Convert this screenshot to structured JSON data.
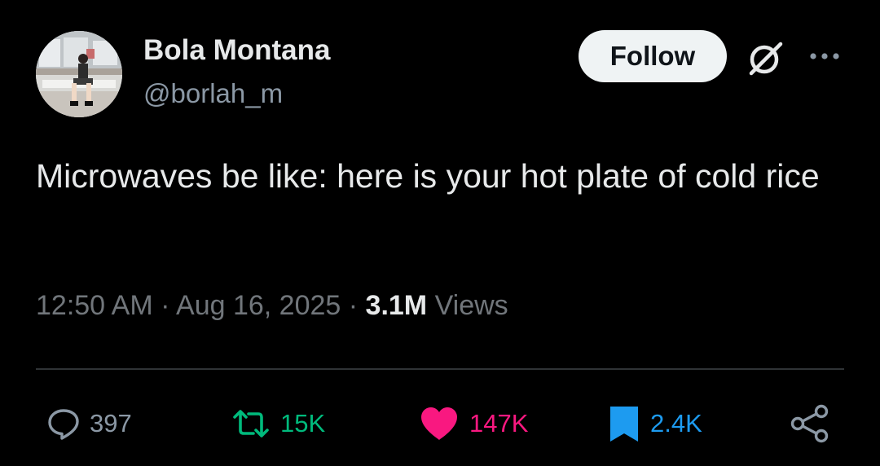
{
  "author": {
    "display_name": "Bola Montana",
    "handle": "@borlah_m"
  },
  "header": {
    "follow_label": "Follow",
    "grok_icon": "grok-icon",
    "more_icon": "more-icon"
  },
  "tweet": {
    "text": "Microwaves be like: here is your hot plate of cold rice"
  },
  "meta": {
    "time": "12:50 AM",
    "separator": "·",
    "date": "Aug 16, 2025",
    "views_count": "3.1M",
    "views_label": "Views"
  },
  "actions": {
    "replies": "397",
    "retweets": "15K",
    "likes": "147K",
    "bookmarks": "2.4K"
  },
  "colors": {
    "background": "#000000",
    "retweet": "#00ba7c",
    "like": "#f91880",
    "bookmark": "#1d9bf0",
    "secondary_text": "#71767b"
  }
}
